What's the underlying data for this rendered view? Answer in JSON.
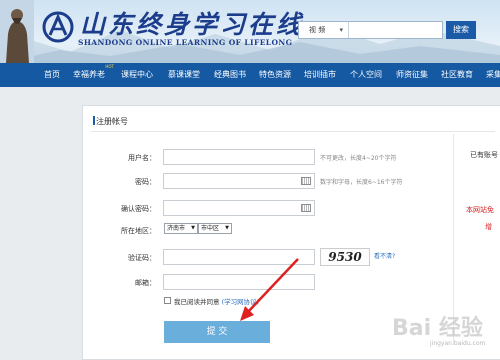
{
  "header": {
    "logo_cn": "山东终身学习在线",
    "logo_en": "SHANDONG ONLINE LEARNING OF LIFELONG",
    "search": {
      "category": "视 频",
      "placeholder": "",
      "button": "搜索"
    }
  },
  "nav": {
    "items": [
      "首页",
      "幸福养老",
      "课程中心",
      "慕课课堂",
      "经典图书",
      "特色资源",
      "培训插市",
      "个人空间",
      "师资征集",
      "社区教育",
      "采集"
    ],
    "hot_badge": "HOT"
  },
  "form": {
    "title": "注册帐号",
    "username_label": "用户名：",
    "username_hint": "不可更改，长度4~20个字符",
    "password_label": "密码：",
    "password_hint": "数字和字母，长度6~16个字符",
    "confirm_label": "确认密码：",
    "region_label": "所在地区：",
    "city": "济南市",
    "district": "市中区",
    "captcha_label": "验证码：",
    "captcha_text": "9530",
    "captcha_refresh": "看不清?",
    "email_label": "邮箱：",
    "agree_text": "我已阅读并同意",
    "agree_link": "(学习网协议)",
    "submit": "提 交"
  },
  "side": {
    "has_account": "已有账号",
    "notice_1": "本网站免",
    "notice_2": "增"
  },
  "watermark": {
    "text": "Bai 经验",
    "url": "jingyan.baidu.com"
  },
  "colors": {
    "nav_bg": "#1659a3",
    "submit_bg": "#6aaedc",
    "annotation_arrow": "#e02020",
    "notice_red": "#d42020"
  }
}
